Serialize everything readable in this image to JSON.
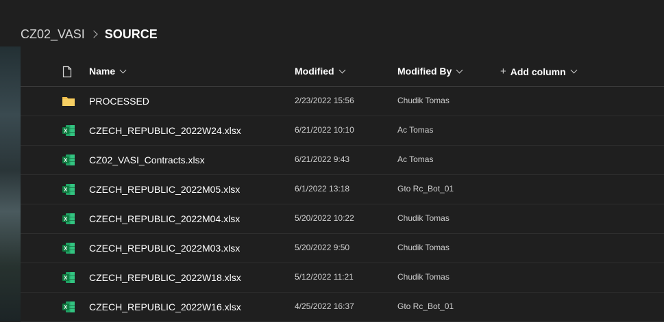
{
  "breadcrumb": {
    "parent": "CZ02_VASI",
    "current": "SOURCE"
  },
  "columns": {
    "name": "Name",
    "modified": "Modified",
    "modified_by": "Modified By",
    "add_column": "Add column"
  },
  "icons": {
    "file_type_header": "document-icon",
    "folder": "folder-icon",
    "excel": "excel-file-icon"
  },
  "colors": {
    "folder": "#f2c14e",
    "excel": "#1f9d55",
    "background": "#1f1f1f"
  },
  "files": [
    {
      "type": "folder",
      "name": "PROCESSED",
      "modified": "2/23/2022 15:56",
      "modified_by": "Chudik Tomas"
    },
    {
      "type": "excel",
      "name": "CZECH_REPUBLIC_2022W24.xlsx",
      "modified": "6/21/2022 10:10",
      "modified_by": "Ac Tomas"
    },
    {
      "type": "excel",
      "name": "CZ02_VASI_Contracts.xlsx",
      "modified": "6/21/2022 9:43",
      "modified_by": "Ac Tomas"
    },
    {
      "type": "excel",
      "name": "CZECH_REPUBLIC_2022M05.xlsx",
      "modified": "6/1/2022 13:18",
      "modified_by": "Gto Rc_Bot_01"
    },
    {
      "type": "excel",
      "name": "CZECH_REPUBLIC_2022M04.xlsx",
      "modified": "5/20/2022 10:22",
      "modified_by": "Chudik Tomas"
    },
    {
      "type": "excel",
      "name": "CZECH_REPUBLIC_2022M03.xlsx",
      "modified": "5/20/2022 9:50",
      "modified_by": "Chudik Tomas"
    },
    {
      "type": "excel",
      "name": "CZECH_REPUBLIC_2022W18.xlsx",
      "modified": "5/12/2022 11:21",
      "modified_by": "Chudik Tomas"
    },
    {
      "type": "excel",
      "name": "CZECH_REPUBLIC_2022W16.xlsx",
      "modified": "4/25/2022 16:37",
      "modified_by": "Gto Rc_Bot_01"
    }
  ]
}
